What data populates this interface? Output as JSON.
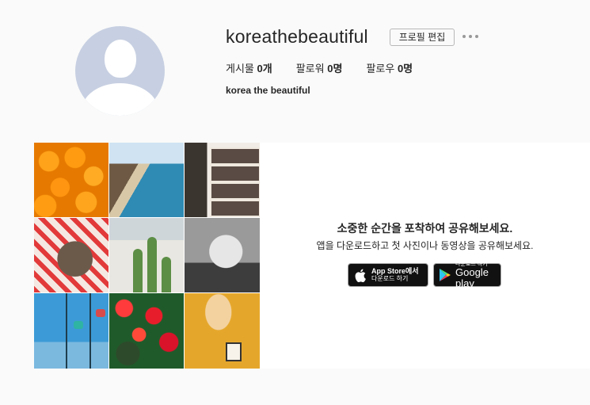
{
  "profile": {
    "username": "koreathebeautiful",
    "edit_button": "프로필 편집",
    "stats": {
      "posts_label": "게시물",
      "posts_value": "0개",
      "followers_label": "팔로워",
      "followers_value": "0명",
      "following_label": "팔로우",
      "following_value": "0명"
    },
    "full_name": "korea the beautiful"
  },
  "empty_state": {
    "title": "소중한 순간을 포착하여 공유해보세요.",
    "subtitle": "앱을 다운로드하고 첫 사진이나 동영상을 공유해보세요.",
    "app_store": {
      "line1": "App Store에서",
      "line2": "다운로드 하기",
      "icon": "apple-icon"
    },
    "google_play": {
      "line1": "다운로드 하기",
      "line2": "Google play",
      "icon": "google-play-icon"
    }
  },
  "sample_photos": [
    "oranges",
    "coastline",
    "photo-booth-strip",
    "dog",
    "cactus",
    "laughing-baby",
    "gondola-ride",
    "red-flowers",
    "cat-with-camera"
  ],
  "colors": {
    "page_bg": "#fafafa",
    "avatar_bg": "#c7d0e2",
    "button_border": "#b8b8b8",
    "store_badge_bg": "#111111"
  }
}
